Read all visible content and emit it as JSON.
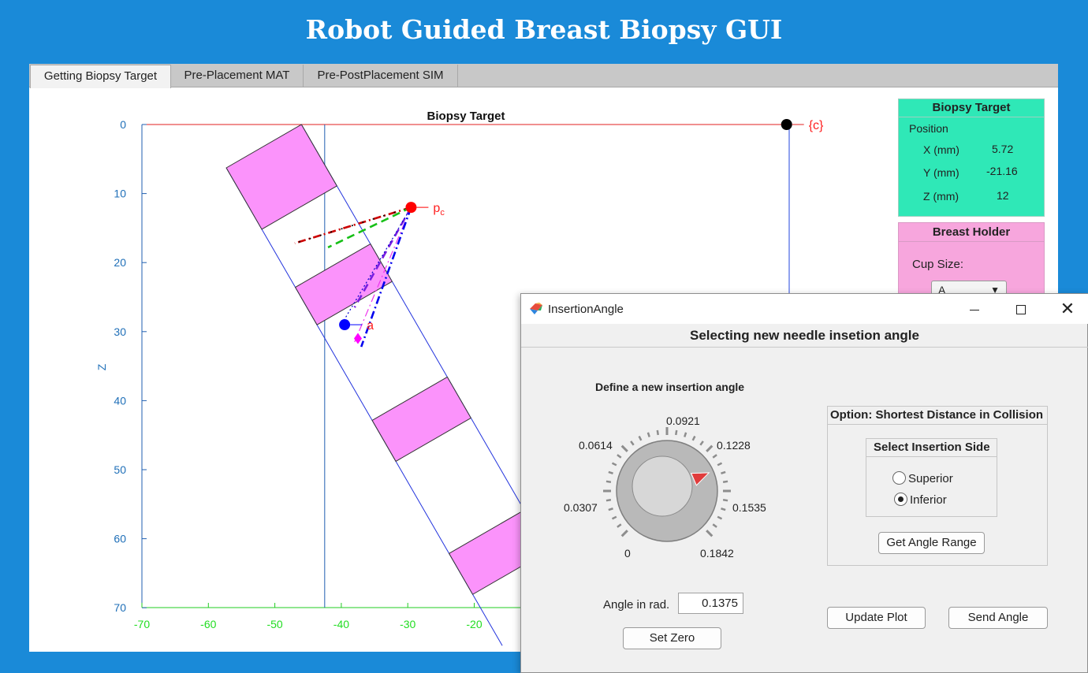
{
  "app_title": "Robot Guided Breast Biopsy GUI",
  "tabs": [
    {
      "label": "Getting Biopsy Target",
      "active": true
    },
    {
      "label": "Pre-Placement MAT",
      "active": false
    },
    {
      "label": "Pre-PostPlacement SIM",
      "active": false
    }
  ],
  "chart_data": {
    "type": "line",
    "title": "Biopsy Target",
    "ylabel": "Z",
    "xlabel": "",
    "xlim": [
      -70,
      20
    ],
    "ylim": [
      0,
      70
    ],
    "y_reversed": true,
    "x_ticks": [
      -70,
      -60,
      -50,
      -40,
      -30,
      -20
    ],
    "y_ticks": [
      0,
      10,
      20,
      30,
      40,
      50,
      60,
      70
    ],
    "points": [
      {
        "label": "{c}",
        "x": 27,
        "z": 0,
        "color": "#000000"
      },
      {
        "label": "pc",
        "x": -29.5,
        "z": 12,
        "color": "#ff0000"
      },
      {
        "label": "a",
        "x": -39.5,
        "z": 29,
        "color": "#0000ff"
      },
      {
        "label": "",
        "x": -37.5,
        "z": 31,
        "color": "#ff00ff",
        "marker": "diamond"
      }
    ],
    "vertical_line_x": -42.5,
    "needle_lines": [
      {
        "from": [
          -29.5,
          12
        ],
        "to": [
          -47,
          17.2
        ],
        "style": "dashdot",
        "color": "#cc0000"
      },
      {
        "from": [
          -29.5,
          12
        ],
        "to": [
          -42,
          17.8
        ],
        "style": "dashed",
        "color": "#17c017"
      },
      {
        "from": [
          -29.5,
          12
        ],
        "to": [
          -38,
          26.5
        ],
        "style": "dashed",
        "color": "#7a1ee0"
      },
      {
        "from": [
          -29.5,
          12
        ],
        "to": [
          -40,
          29
        ],
        "style": "dotted",
        "color": "#0000cc"
      },
      {
        "from": [
          -29.5,
          12
        ],
        "to": [
          -38,
          31.5
        ],
        "style": "dashdot",
        "color": "#ee33ee"
      },
      {
        "from": [
          -29.5,
          12
        ],
        "to": [
          -37,
          32.2
        ],
        "style": "dashdot",
        "color": "#0000ee"
      }
    ]
  },
  "biopsy_target": {
    "header": "Biopsy Target",
    "position_label": "Position",
    "x_label": "X (mm)",
    "x_value": "5.72",
    "y_label": "Y (mm)",
    "y_value": "-21.16",
    "z_label": "Z (mm)",
    "z_value": "12"
  },
  "breast_holder": {
    "header": "Breast Holder",
    "cup_size_label": "Cup Size:",
    "cup_size_value": "A"
  },
  "dialog": {
    "title": "InsertionAngle",
    "heading": "Selecting new needle insetion angle",
    "knob_caption": "Define a new insertion angle",
    "knob_labels": [
      "0",
      "0.0307",
      "0.0614",
      "0.0921",
      "0.1228",
      "0.1535",
      "0.1842"
    ],
    "knob_value": 0.1375,
    "knob_min": 0,
    "knob_max": 0.1842,
    "angle_label": "Angle in rad.",
    "angle_value": "0.1375",
    "set_zero": "Set Zero",
    "option_title": "Option: Shortest Distance in Collision",
    "side_title": "Select Insertion Side",
    "side_options": [
      "Superior",
      "Inferior"
    ],
    "side_selected": "Inferior",
    "get_range": "Get Angle Range",
    "update_plot": "Update Plot",
    "send_angle": "Send Angle"
  }
}
